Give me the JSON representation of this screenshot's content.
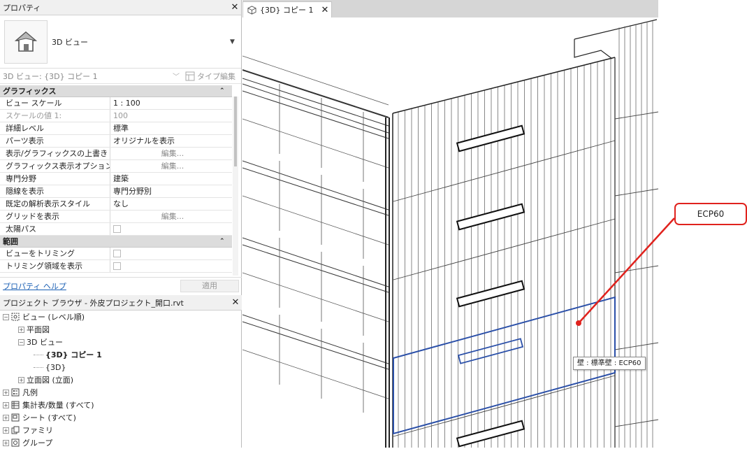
{
  "properties": {
    "title": "プロパティ",
    "type_name": "3D ビュー",
    "selector": "3D ビュー: {3D} コピー 1",
    "type_edit": "タイプ編集",
    "groups": [
      {
        "name": "グラフィックス",
        "rows": [
          {
            "key": "ビュー スケール",
            "value": "1 : 100"
          },
          {
            "key": "スケールの値    1:",
            "value": "100",
            "dim": true
          },
          {
            "key": "詳細レベル",
            "value": "標準"
          },
          {
            "key": "パーツ表示",
            "value": "オリジナルを表示"
          },
          {
            "key": "表示/グラフィックスの上書き",
            "value": "編集...",
            "button": true
          },
          {
            "key": "グラフィックス表示オプション",
            "value": "編集...",
            "button": true
          },
          {
            "key": "専門分野",
            "value": "建築"
          },
          {
            "key": "隠線を表示",
            "value": "専門分野別"
          },
          {
            "key": "既定の解析表示スタイル",
            "value": "なし"
          },
          {
            "key": "グリッドを表示",
            "value": "編集...",
            "button": true
          },
          {
            "key": "太陽パス",
            "checkbox": true
          }
        ]
      },
      {
        "name": "範囲",
        "rows": [
          {
            "key": "ビューをトリミング",
            "checkbox": true
          },
          {
            "key": "トリミング領域を表示",
            "checkbox": true
          }
        ]
      }
    ],
    "help_link": "プロパティ ヘルプ",
    "apply": "適用"
  },
  "browser": {
    "title": "プロジェクト ブラウザ - 外皮プロジェクト_開口.rvt",
    "tree": [
      {
        "label": "ビュー (レベル順)",
        "level": 0,
        "exp": "−",
        "icon": "views-icon"
      },
      {
        "label": "平面図",
        "level": 1,
        "exp": "+"
      },
      {
        "label": "3D ビュー",
        "level": 1,
        "exp": "−"
      },
      {
        "label": "{3D} コピー 1",
        "level": 2,
        "bold": true
      },
      {
        "label": "{3D}",
        "level": 2
      },
      {
        "label": "立面図 (立面)",
        "level": 1,
        "exp": "+"
      },
      {
        "label": "凡例",
        "level": 0,
        "exp": "+",
        "icon": "legend-icon"
      },
      {
        "label": "集計表/数量 (すべて)",
        "level": 0,
        "exp": "+",
        "icon": "schedule-icon"
      },
      {
        "label": "シート (すべて)",
        "level": 0,
        "exp": "+",
        "icon": "sheet-icon"
      },
      {
        "label": "ファミリ",
        "level": 0,
        "exp": "+",
        "icon": "family-icon"
      },
      {
        "label": "グループ",
        "level": 0,
        "exp": "+",
        "icon": "group-icon"
      }
    ]
  },
  "view_tab": {
    "label": "{3D} コピー 1"
  },
  "callout": {
    "label": "ECP60"
  },
  "tooltip": {
    "label": "壁 : 標準壁 : ECP60"
  },
  "colors": {
    "accent_red": "#e0221d",
    "selection_blue": "#2a4fa8"
  }
}
